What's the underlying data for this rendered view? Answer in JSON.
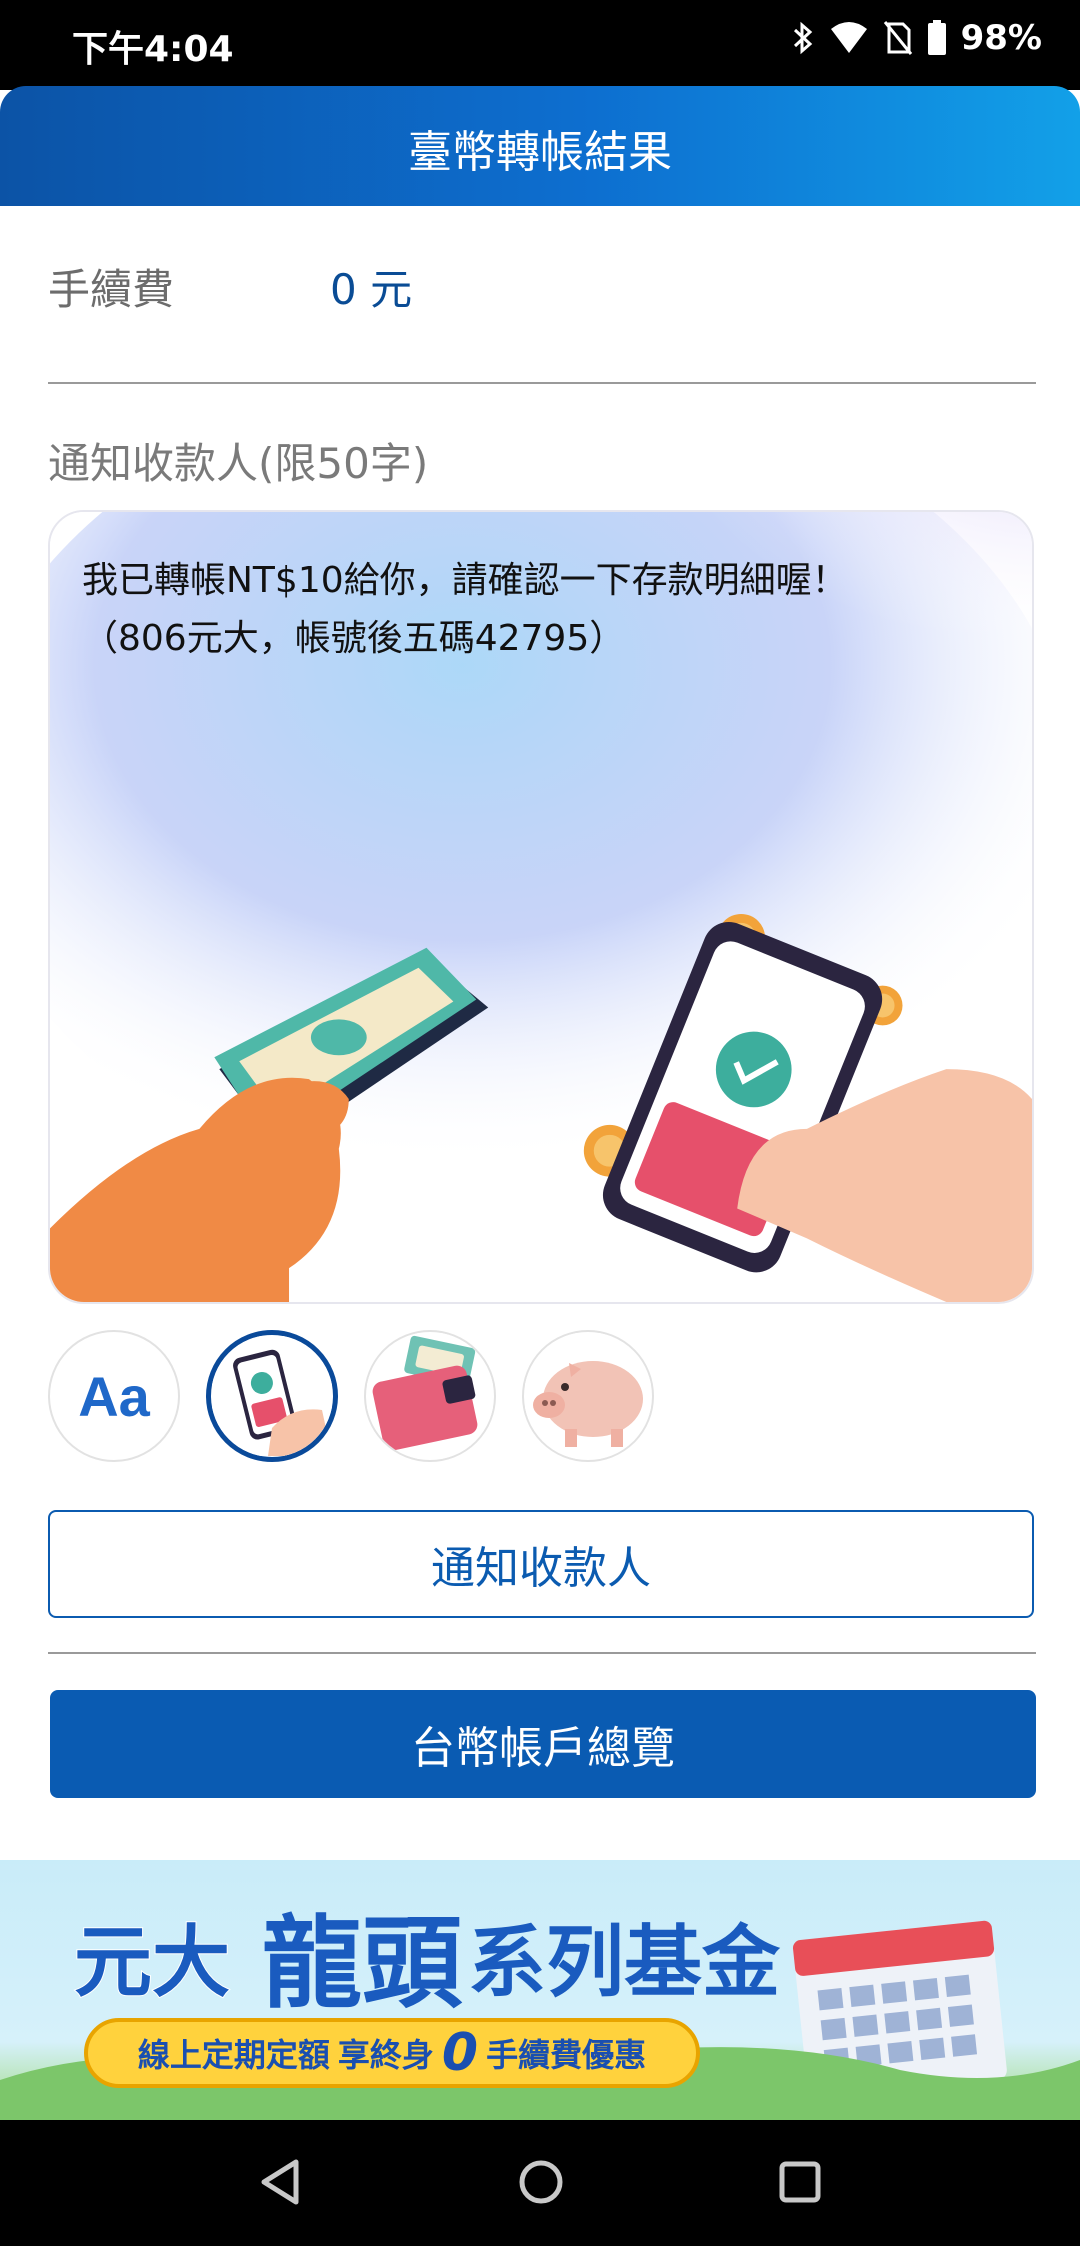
{
  "status_bar": {
    "time": "下午4:04",
    "battery": "98%",
    "icons": [
      "bluetooth-icon",
      "wifi-icon",
      "no-sim-icon",
      "battery-icon"
    ]
  },
  "header": {
    "title": "臺幣轉帳結果"
  },
  "fee": {
    "label": "手續費",
    "value": "0 元"
  },
  "notify": {
    "label": "通知收款人(限50字)",
    "message": "我已轉帳NT$10給你，請確認一下存款明細喔！\n（806元大，帳號後五碼42795）",
    "templates": [
      {
        "name": "text-only",
        "label": "Aa",
        "selected": false
      },
      {
        "name": "phone-payment",
        "selected": true
      },
      {
        "name": "wallet",
        "selected": false
      },
      {
        "name": "piggy-bank",
        "selected": false
      }
    ]
  },
  "buttons": {
    "notify_recipient": "通知收款人",
    "account_overview": "台幣帳戶總覽"
  },
  "banner": {
    "title_part1": "元大",
    "title_part2": "龍頭",
    "title_part3": "系列基金",
    "subtitle_part1": "線上定期定額",
    "subtitle_part2": "享終身",
    "subtitle_zero": "0",
    "subtitle_part3": "手續費優惠"
  },
  "nav_bar": {
    "icons": [
      "back-icon",
      "home-icon",
      "recents-icon"
    ]
  },
  "colors": {
    "primary": "#0a5bb2",
    "header_start": "#0c53a6",
    "header_end": "#12a0e8",
    "text_blue": "#0a4c95"
  }
}
